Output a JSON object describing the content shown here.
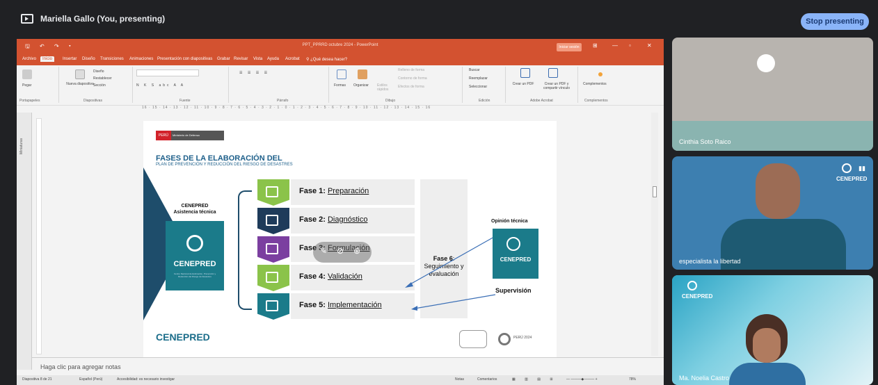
{
  "meet": {
    "presenter_name": "Mariella Gallo (You, presenting)",
    "stop_label": "Stop presenting"
  },
  "ppt": {
    "window_title": "PPT_PPRRD octubre 2024 - PowerPoint",
    "signin_label": "Iniciar sesión",
    "tabs": [
      "Archivo",
      "Inicio",
      "Insertar",
      "Diseño",
      "Transiciones",
      "Animaciones",
      "Presentación con diapositivas",
      "Grabar",
      "Revisar",
      "Vista",
      "Ayuda",
      "Acrobat",
      "¿Qué desea hacer?"
    ],
    "groups": [
      "Portapapeles",
      "Diapositivas",
      "Fuente",
      "Párrafo",
      "Dibujo",
      "Edición",
      "Adobe Acrobat",
      "Complementos"
    ],
    "ribbon": {
      "pegar": "Pegar",
      "nueva": "Nueva diapositiva",
      "diseno": "Diseño",
      "restablecer": "Restablecer",
      "seccion": "Sección",
      "formas": "Formas",
      "organizar": "Organizar",
      "estilos": "Estilos rápidos",
      "relleno": "Relleno de forma",
      "contorno": "Contorno de forma",
      "efectos": "Efectos de forma",
      "buscar": "Buscar",
      "reemplazar": "Reemplazar",
      "seleccionar": "Seleccionar",
      "crear_pdf": "Crear un PDF",
      "crear_pdf2": "Crear un PDF y compartir vínculo",
      "complementos": "Complementos"
    },
    "ruler": "16 · 15 · 14 · 13 · 12 · 11 · 10 · 9 · 8 · 7 · 6 · 5 · 4 · 3 · 2 · 1 · 0 · 1 · 2 · 3 · 4 · 5 · 6 · 7 · 8 · 9 · 10 · 11 · 12 · 13 · 14 · 15 · 16",
    "thumbs_label": "Miniaturas",
    "notes_placeholder": "Haga clic para agregar notas",
    "status": {
      "slide": "Diapositiva 8 de 21",
      "lang": "Español (Perú)",
      "access": "Accesibilidad: es necesario investigar",
      "notes": "Notas",
      "comments": "Comentarios",
      "zoom": "78%"
    }
  },
  "slide": {
    "peru_label": "PERÚ",
    "ministry": "Ministerio de Defensa",
    "title": "FASES DE LA ELABORACIÓN DEL",
    "subtitle": "PLAN DE PREVENCIÓN Y REDUCCIÓN DEL RIESGO DE DESASTRES",
    "cenepred_title": "CENEPRED",
    "asistencia": "Asistencia técnica",
    "logo_name": "CENEPRED",
    "logo_desc": "Centro Nacional de Estimación, Prevención y Reducción del Riesgo de Desastres",
    "phases": [
      {
        "label": "Fase 1: ",
        "name": "Preparación",
        "color": "#8bc34a"
      },
      {
        "label": "Fase 2: ",
        "name": "Diagnóstico",
        "color": "#1e3b5a"
      },
      {
        "label": "Fase 3: ",
        "name": "Formulación",
        "color": "#7b3fa0"
      },
      {
        "label": "Fase 4: ",
        "name": "Validación",
        "color": "#8bc34a"
      },
      {
        "label": "Fase 5: ",
        "name": "Implementación",
        "color": "#1b7b8a"
      }
    ],
    "fase6": "Fase 6",
    "fase6_text": ": Seguimiento y evaluación",
    "opinion": "Opinión técnica",
    "supervision": "Supervisión",
    "footer_logo": "CENEPRED",
    "bicentenario": "PERÚ 2024"
  },
  "participants": [
    {
      "name": "Cinthia Soto Raico"
    },
    {
      "name": "especialista la libertad",
      "org": "CENEPRED"
    },
    {
      "name": "Ma. Noelia Castro",
      "org": "CENEPRED"
    }
  ]
}
